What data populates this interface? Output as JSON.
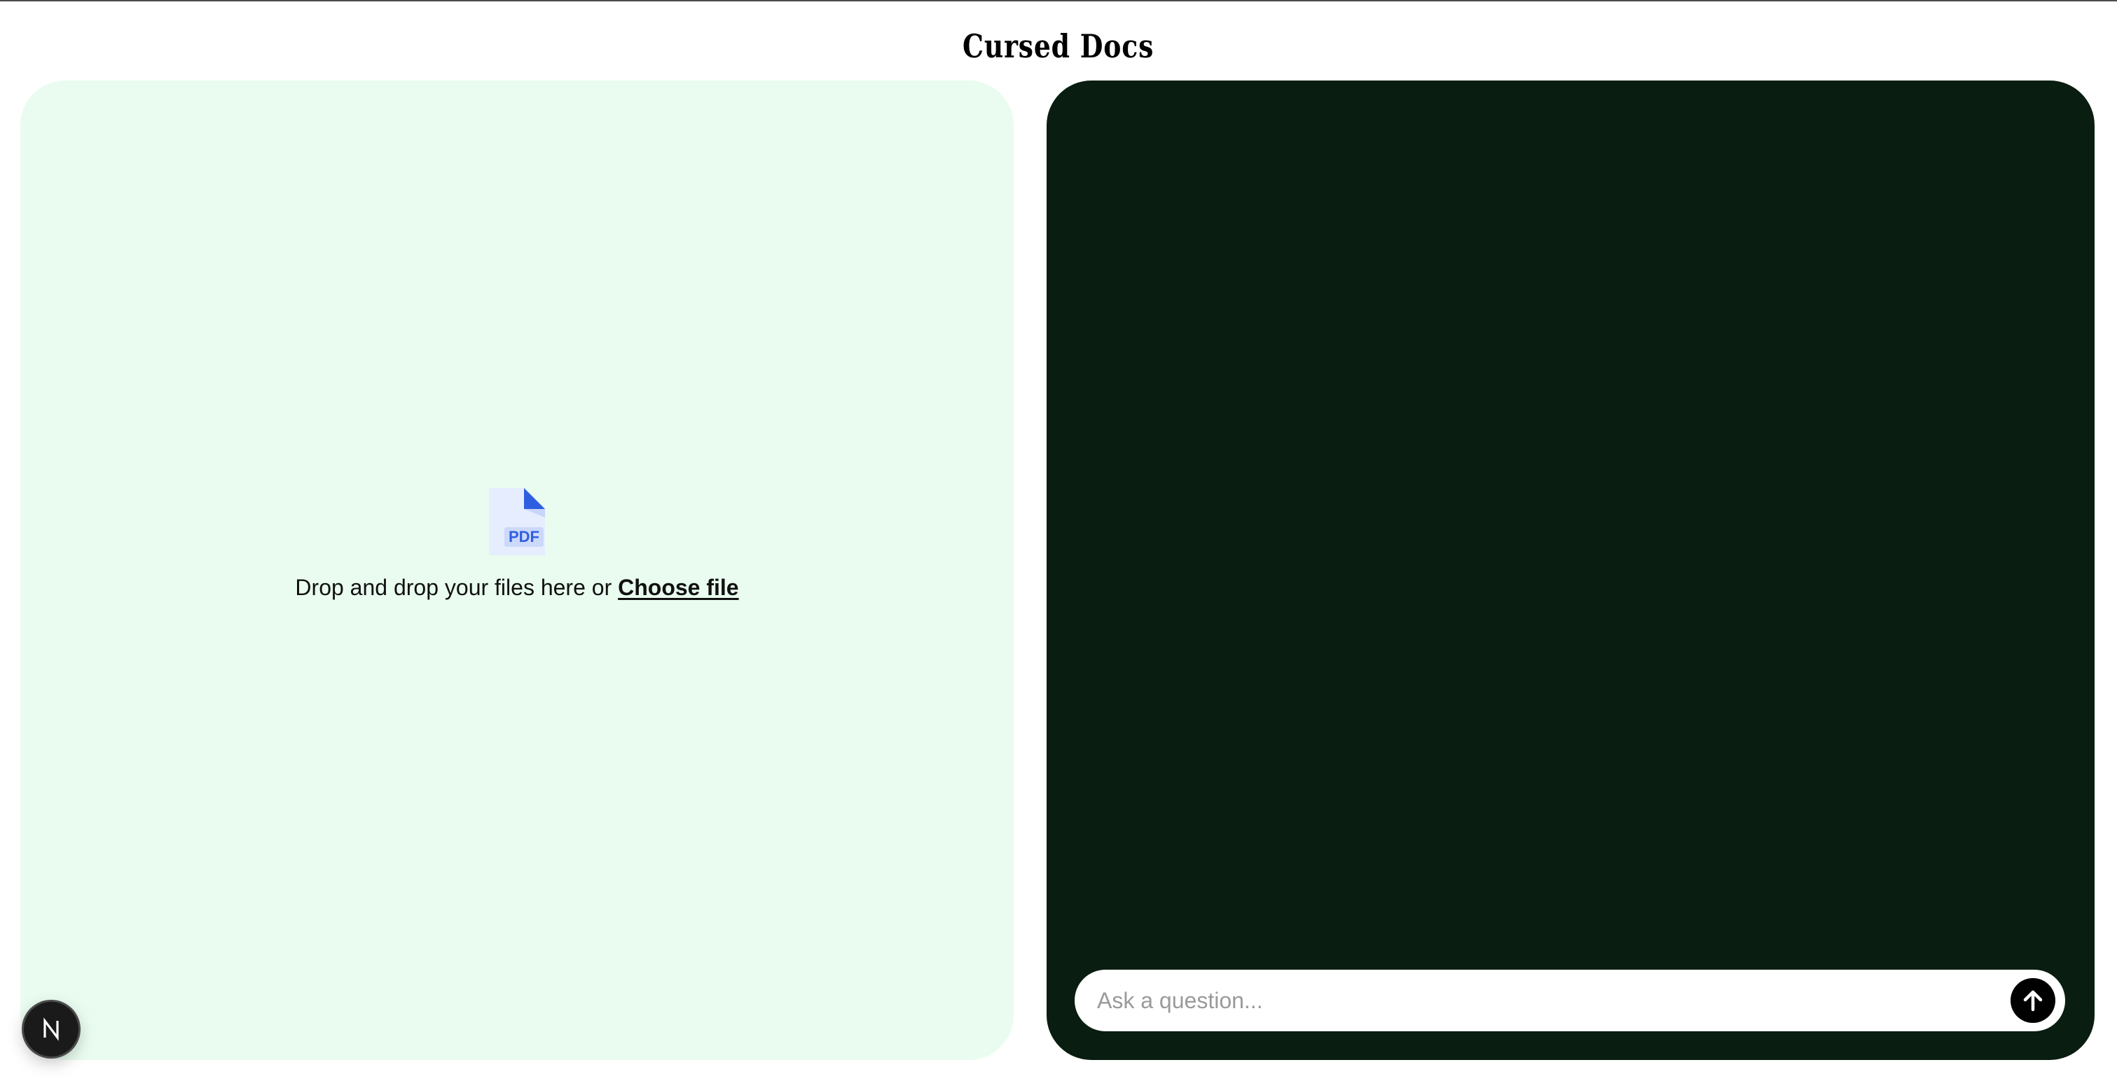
{
  "app": {
    "title": "Cursed Docs"
  },
  "upload": {
    "icon": "pdf-file-icon",
    "icon_label": "PDF",
    "drop_text": "Drop and drop your files here or ",
    "choose_label": "Choose file"
  },
  "chat": {
    "input_placeholder": "Ask a question...",
    "input_value": "",
    "send_icon": "arrow-up-icon"
  },
  "dev_badge": {
    "icon": "nextjs-logo-icon",
    "letter": "N"
  },
  "colors": {
    "upload_panel_bg": "#e9fcef",
    "chat_panel_bg": "#091d11",
    "pdf_icon_accent": "#2f5fe0",
    "pdf_icon_bg": "#e6edff",
    "send_button_bg": "#000000"
  }
}
